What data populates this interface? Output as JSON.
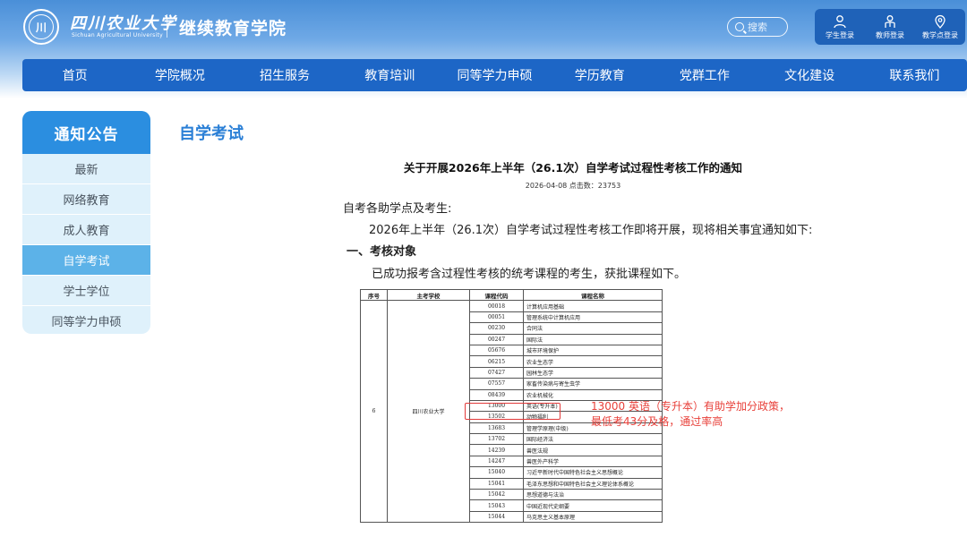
{
  "header": {
    "logo_cn": "四川农业大学",
    "logo_en": "Sichuan Agricultural University",
    "logo_seal_text": "川",
    "college_name": "继续教育学院",
    "search_placeholder": "搜索",
    "logins": [
      {
        "label": "学生登录",
        "icon": "student-icon"
      },
      {
        "label": "教师登录",
        "icon": "teacher-icon"
      },
      {
        "label": "教学点登录",
        "icon": "location-icon"
      }
    ]
  },
  "nav": [
    "首页",
    "学院概况",
    "招生服务",
    "教育培训",
    "同等学力申硕",
    "学历教育",
    "党群工作",
    "文化建设",
    "联系我们"
  ],
  "sidebar": {
    "title": "通知公告",
    "items": [
      "最新",
      "网络教育",
      "成人教育",
      "自学考试",
      "学士学位",
      "同等学力申硕"
    ],
    "active_index": 3
  },
  "main": {
    "section_title": "自学考试",
    "article_title": "关于开展2026年上半年（26.1次）自学考试过程性考核工作的通知",
    "meta": "2026-04-08 点击数：23753",
    "greeting": "自考各助学点及考生:",
    "intro": "2026年上半年（26.1次）自学考试过程性考核工作即将开展，现将相关事宜通知如下:",
    "heading1": "一、考核对象",
    "desc": "已成功报考含过程性考核的统考课程的考生，获批课程如下。"
  },
  "table": {
    "headers": [
      "序号",
      "主考学校",
      "课程代码",
      "课程名称"
    ],
    "seq": "6",
    "school": "四川农业大学",
    "rows": [
      {
        "code": "00018",
        "name": "计算机应用基础"
      },
      {
        "code": "00051",
        "name": "管理系统中计算机应用"
      },
      {
        "code": "00230",
        "name": "合同法"
      },
      {
        "code": "00247",
        "name": "国际法"
      },
      {
        "code": "05676",
        "name": "城市环境保护"
      },
      {
        "code": "06215",
        "name": "农业生态学"
      },
      {
        "code": "07427",
        "name": "园林生态学"
      },
      {
        "code": "07557",
        "name": "家畜传染病与寄生虫学"
      },
      {
        "code": "08439",
        "name": "农业机械化"
      },
      {
        "code": "13000",
        "name": "英语(专升本)"
      },
      {
        "code": "13502",
        "name": "动物福利"
      },
      {
        "code": "13683",
        "name": "管理学原理(中级)"
      },
      {
        "code": "13702",
        "name": "国际经济法"
      },
      {
        "code": "14239",
        "name": "兽医法规"
      },
      {
        "code": "14247",
        "name": "兽医外产科学"
      },
      {
        "code": "15040",
        "name": "习近平新时代中国特色社会主义思想概论"
      },
      {
        "code": "15041",
        "name": "毛泽东思想和中国特色社会主义理论体系概论"
      },
      {
        "code": "15042",
        "name": "思想道德与法治"
      },
      {
        "code": "15043",
        "name": "中国近现代史纲要"
      },
      {
        "code": "15044",
        "name": "马克思主义基本原理"
      }
    ]
  },
  "annotation": {
    "line1": "13000 英语（专升本）有助学加分政策，",
    "line2": "最低考43分及格，通过率高",
    "color": "#e8403a"
  },
  "colors": {
    "nav_bg": "#1d66c6",
    "sidebar_title_bg": "#2b8ee0",
    "sidebar_active_bg": "#5cb2e8",
    "section_title": "#2a7fd6"
  }
}
